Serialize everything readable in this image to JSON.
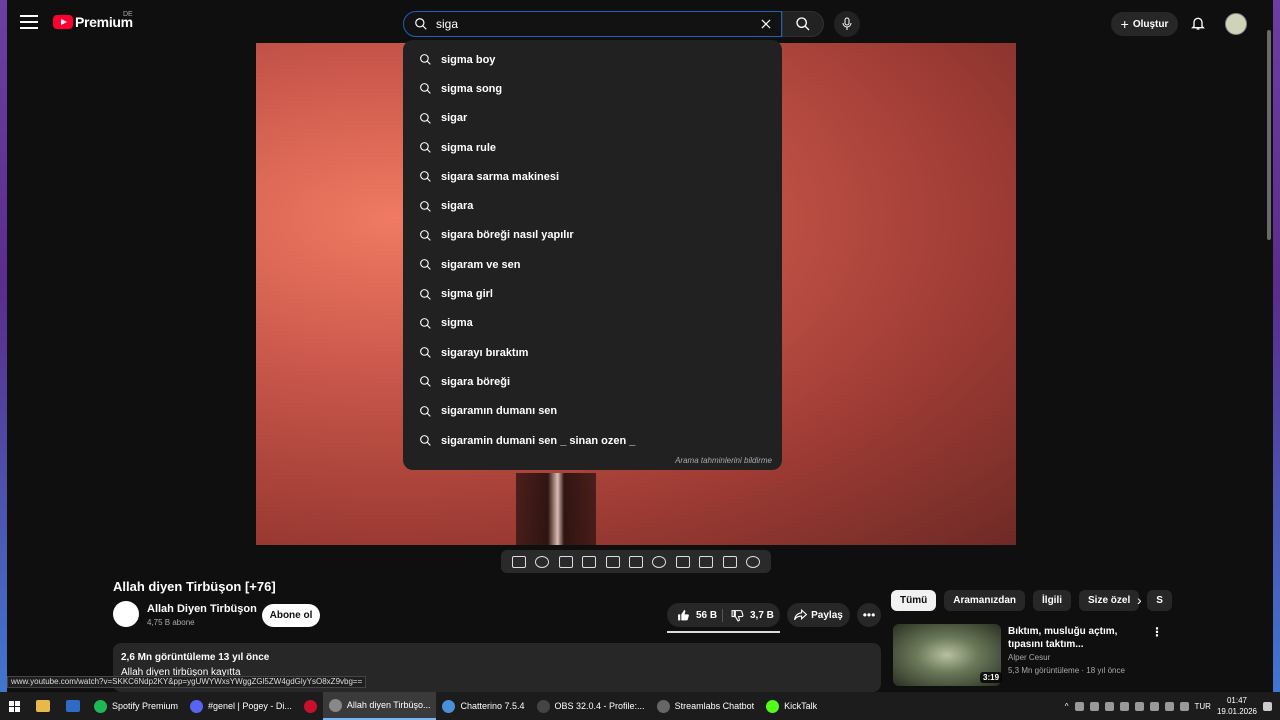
{
  "header": {
    "logo_text": "Premium",
    "region": "DE",
    "search_value": "siga",
    "create_label": "Oluştur"
  },
  "suggestions": [
    "sigma boy",
    "sigma song",
    "sigar",
    "sigma rule",
    "sigara sarma makinesi",
    "sigara",
    "sigara böreği nasıl yapılır",
    "sigaram ve sen",
    "sigma girl",
    "sigma",
    "sigarayı bıraktım",
    "sigara böreği",
    "sigaramın dumanı sen",
    "sigaramin dumani sen _ sinan ozen _"
  ],
  "suggestions_report": "Arama tahminlerini bildirme",
  "video": {
    "title": "Allah diyen Tirbüşon [+76]",
    "channel": "Allah Diyen Tirbüşon",
    "subscribers": "4,75 B abone",
    "subscribe_label": "Abone ol",
    "likes": "56 B",
    "dislikes": "3,7 B",
    "share_label": "Paylaş",
    "stats": "2,6 Mn görüntüleme  13 yıl önce",
    "description": "Allah diyen tirbüşon kayıtta"
  },
  "chips": [
    "Tümü",
    "Aramanızdan",
    "İlgili",
    "Size özel",
    "S"
  ],
  "recommendation": {
    "title": "Bıktım, musluğu açtım, tıpasını taktım...",
    "channel": "Alper Cesur",
    "meta": "5,3 Mn görüntüleme · 18 yıl önce",
    "duration": "3:19"
  },
  "status_url": "www.youtube.com/watch?v=SKKC6Ndp2KY&pp=ygUWYWxsYWggZGl5ZW4gdGlyYsO8xZ9vbg==",
  "taskbar": {
    "apps": [
      {
        "label": "Spotify Premium",
        "color": "#1db954"
      },
      {
        "label": "#genel | Pogey - Di...",
        "color": "#5865f2"
      },
      {
        "label": "",
        "color": "#c8102e"
      },
      {
        "label": "Allah diyen Tirbüşo...",
        "color": "#888888"
      },
      {
        "label": "Chatterino 7.5.4",
        "color": "#4a90d9"
      },
      {
        "label": "OBS 32.0.4 - Profile:...",
        "color": "#444444"
      },
      {
        "label": "Streamlabs Chatbot",
        "color": "#666666"
      },
      {
        "label": "KickTalk",
        "color": "#53fc18"
      }
    ],
    "lang": "TUR",
    "time": "01:47",
    "date": "19.01.2026"
  }
}
